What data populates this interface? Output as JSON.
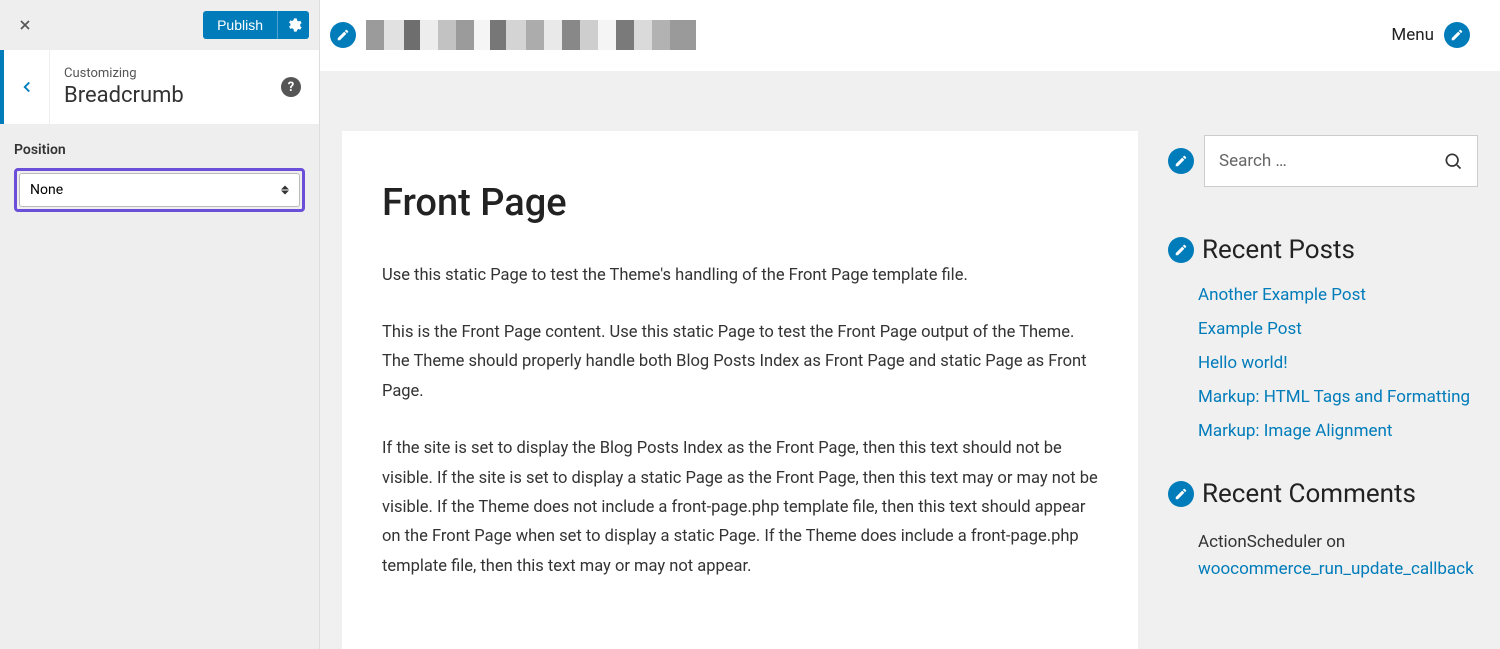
{
  "customizer": {
    "publish_label": "Publish",
    "section_small": "Customizing",
    "section_title": "Breadcrumb",
    "control": {
      "label": "Position",
      "selected": "None"
    }
  },
  "preview": {
    "header": {
      "menu_label": "Menu"
    },
    "main": {
      "title": "Front Page",
      "p1": "Use this static Page to test the Theme's handling of the Front Page template file.",
      "p2": "This is the Front Page content. Use this static Page to test the Front Page output of the Theme. The Theme should properly handle both Blog Posts Index as Front Page and static Page as Front Page.",
      "p3": "If the site is set to display the Blog Posts Index as the Front Page, then this text should not be visible. If the site is set to display a static Page as the Front Page, then this text may or may not be visible. If the Theme does not include a front-page.php template file, then this text should appear on the Front Page when set to display a static Page. If the Theme does include a front-page.php template file, then this text may or may not appear."
    },
    "sidebar": {
      "search_placeholder": "Search …",
      "recent_posts": {
        "title": "Recent Posts",
        "items": [
          "Another Example Post",
          "Example Post",
          "Hello world!",
          "Markup: HTML Tags and Formatting",
          "Markup: Image Alignment"
        ]
      },
      "recent_comments": {
        "title": "Recent Comments",
        "item": {
          "author": "ActionScheduler",
          "on": " on ",
          "target": "woocommerce_run_update_callback"
        }
      }
    }
  }
}
